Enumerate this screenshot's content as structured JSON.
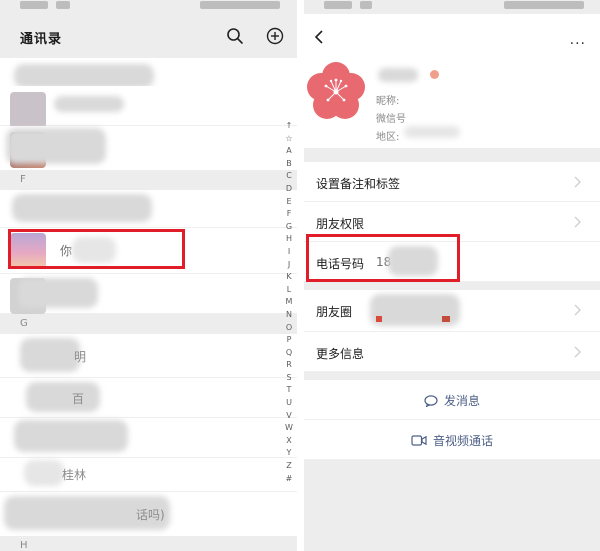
{
  "contacts_screen": {
    "title": "通讯录",
    "search_icon": "search-icon",
    "add_icon": "add-icon",
    "sections": [
      {
        "letter": "F"
      },
      {
        "letter": "G"
      },
      {
        "letter": "H"
      }
    ],
    "visible_row_text": {
      "highlighted_contact_partial": "你",
      "row_g1_partial": "明",
      "row_g2_partial": "百",
      "row_guilin": "桂林",
      "row_last_partial": "话吗)"
    },
    "index_letters": [
      "↑",
      "☆",
      "A",
      "B",
      "C",
      "D",
      "E",
      "F",
      "G",
      "H",
      "I",
      "J",
      "K",
      "L",
      "M",
      "N",
      "O",
      "P",
      "Q",
      "R",
      "S",
      "T",
      "U",
      "V",
      "W",
      "X",
      "Y",
      "Z",
      "#"
    ]
  },
  "profile_screen": {
    "back_icon": "chevron-left-icon",
    "more_label": "···",
    "nickname_label": "昵称:",
    "wechat_id_label": "微信号",
    "region_label": "地区:",
    "cells": {
      "remark_tags": "设置备注和标签",
      "friend_permissions": "朋友权限",
      "phone": "电话号码",
      "phone_prefix": "18",
      "moments": "朋友圈",
      "more_info": "更多信息"
    },
    "actions": {
      "send_message": "发消息",
      "video_call": "音视频通话"
    }
  },
  "colors": {
    "highlight_red": "#e11d2a",
    "link_blue": "#576b95",
    "flower_red": "#e8696f"
  }
}
